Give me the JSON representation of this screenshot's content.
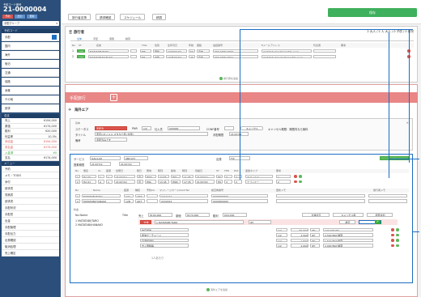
{
  "sidebar": {
    "top_label": "予約コード番号",
    "booking_code": "21-0000004",
    "badges": [
      "予約",
      "出力",
      "更新"
    ],
    "select_value": "手配グループ",
    "section_top": "予約コード",
    "items_a": [
      {
        "label": "手配",
        "value": ""
      },
      {
        "label": "国内",
        "value": ""
      },
      {
        "label": "海外",
        "value": ""
      },
      {
        "label": "宿泊",
        "value": ""
      },
      {
        "label": "交通",
        "value": ""
      },
      {
        "label": "保険",
        "value": ""
      },
      {
        "label": "添乗",
        "value": ""
      },
      {
        "label": "その他",
        "value": ""
      },
      {
        "label": "請求",
        "value": ""
      }
    ],
    "section_money": "収支",
    "items_b": [
      {
        "label": "売上",
        "value": "¥194,000"
      },
      {
        "label": "原価",
        "value": "¥174,000"
      },
      {
        "label": "粗利",
        "value": "¥20,000"
      },
      {
        "label": "利益率",
        "value": "10.3%"
      },
      {
        "label": "未収金",
        "value": "¥194,000"
      },
      {
        "label": "未払金",
        "value": "¥174,000"
      },
      {
        "label": "入金済",
        "value": "¥0"
      },
      {
        "label": "支払",
        "value": "¥174,000"
      }
    ],
    "section_links": "メニュー",
    "items_c": [
      "予約",
      "メモ・TODO",
      "添付",
      "請求書",
      "見積書",
      "請求書",
      "手配状況",
      "手配書",
      "出金",
      "手配管理"
    ],
    "items_d": [
      "手配出力",
      "出発確認",
      "取消処理",
      "売上確定"
    ]
  },
  "toolbar": {
    "buttons": [
      "旅行者名簿",
      "請求確認",
      "スケジュール",
      "精算"
    ],
    "save": "保存"
  },
  "travelers": {
    "title": "旅行者",
    "counts": "2 大人 / 2 人 大人 / 0 子供 / 0 幼児",
    "tabs": [
      "全体",
      "手配",
      "保険",
      "精算"
    ],
    "headers": [
      "No",
      "ST",
      "名前",
      "Title",
      "性別",
      "生年月日",
      "年齢",
      "国籍",
      "電話番号",
      "Eメールアドレス",
      "代表者",
      "備考"
    ],
    "rows": [
      {
        "no": "1",
        "st": "OK",
        "name": "MATATABI/TARO",
        "title": "MR",
        "sex": "男性",
        "dob": "1970/01/01",
        "age": "50",
        "country": "日本",
        "tel": "090-0000-0000",
        "email": "matatabi-taro@agentdx.co.jp"
      },
      {
        "no": "2",
        "st": "OK",
        "name": "MATATABI/HANAKO",
        "title": "MS",
        "sex": "女性",
        "dob": "1975/01/01",
        "age": "46",
        "country": "日本",
        "tel": "090-0000-0001",
        "email": "matatabi-hanako@agentdx.co.jp"
      }
    ],
    "add_label": "旅行者を追加"
  },
  "trip": {
    "section_title": "手配旅行",
    "subsection_title": "海外エア",
    "form": {
      "status_label": "ステータス",
      "status_value": "手配済",
      "pnr_label": "PNR",
      "pnr_value": "1/2",
      "vendor_label": "仕入先",
      "vendor_value": "000000",
      "confirm_label": "CONF番号",
      "cancel_label": "キャンセル",
      "cancel_note": "キャンセル期限：期限内なら無料",
      "title_label": "タイトル",
      "title_value": "東京⇔ホノルル マタタビ様 (往復)",
      "dates_label": "手配期間",
      "dates_value": "21/07/12",
      "remarks_label": "備考",
      "remarks_value": "手配済みです"
    },
    "air": {
      "service_label": "サービス",
      "service_value": "GAL/LAO",
      "group_value": "ABC123",
      "date_range_label": "搭乗期間",
      "date_from": "21/07/12",
      "date_to": "21/07/19",
      "dep_label": "出発",
      "dep_value": "FIX",
      "headers": [
        "No",
        "便名",
        "CL",
        "座席",
        "出発日",
        "曜日",
        "発地",
        "時刻",
        "着地",
        "時刻",
        "到着日",
        "ST",
        "TER",
        "PAX",
        "運賃タイプ",
        "備考"
      ],
      "rows": [
        {
          "no": "1",
          "flight": "HA 00",
          "cl": "A",
          "seat": "1",
          "date": "21/07/12",
          "dow": "月",
          "from": "HND",
          "dep": "22:55",
          "to": "HNL",
          "arr": "11:05",
          "adate": "21/07/12",
          "st": "HK",
          "ter": "3",
          "pax": "2",
          "type": "エコノミー",
          "note": "1"
        },
        {
          "no": "2",
          "flight": "HA 01",
          "cl": "A",
          "seat": "1",
          "date": "21/07/19",
          "dow": "月",
          "from": "HNL",
          "dep": "13:45",
          "to": "HND",
          "arr": "17:35",
          "adate": "21/07/20",
          "st": "HK",
          "ter": "3",
          "pax": "2",
          "type": "エコノミー",
          "note": "2"
        }
      ]
    },
    "pax": {
      "headers": [
        "No",
        "Name",
        "座席",
        "種別",
        "予約CA",
        "マイレージカード/Card No",
        "航空券番号",
        "更新メモ",
        "旅行者メモ"
      ],
      "rows": [
        {
          "no": "1",
          "name": "MATATABI/TARO",
          "seat": "12A",
          "type": "ADT",
          "ca": "",
          "mile": "1111111",
          "ticket": "0000000000"
        },
        {
          "no": "2",
          "name": "MATATABI/HANAKO",
          "seat": "12B",
          "type": "ADT",
          "ca": "",
          "mile": "2222222",
          "ticket": "0000000000"
        }
      ]
    },
    "fare": {
      "noname_label": "No Name",
      "title_label": "Title",
      "names": [
        "1 MATATABI/TARO",
        "2 MATATABI/HANAKO"
      ],
      "sales_label": "売上",
      "sales_value": "¥194,000",
      "cost_label": "原価",
      "cost_value": "¥174,000",
      "profit_label": "粗利",
      "profit_value": "¥20,000",
      "per_label": "1人あたり",
      "btn_all": "全体表示",
      "btn_cancel": "キャンセル料",
      "btn_add": "項目追加",
      "payer_value": "1 MATATABI/TARO",
      "payer_badge": "全体",
      "currency": "JPY",
      "ok_label": "確定",
      "lines": [
        {
          "label": "航空運賃",
          "qty": "1/2",
          "price": "90,000",
          "cur": "JPY",
          "total": "174,000 JPY"
        },
        {
          "label": "燃油サーチャージ",
          "qty": "1/2",
          "price": "2,500",
          "cur": "JPY",
          "total": "2,500 BSP 精算"
        },
        {
          "label": "空港使用料",
          "qty": "1/2",
          "price": "1,500",
          "cur": "JPY",
          "total": "1,500 BSP 精算"
        },
        {
          "label": "出入国税等",
          "qty": "1/2",
          "price": "2,000",
          "cur": "JPY",
          "total": "2,000 BSP 精算"
        }
      ]
    },
    "add_air": "海外エアを追加"
  },
  "colors": {
    "primary": "#2b4f7a",
    "accent": "#1b6ec2",
    "save": "#3fb05d",
    "danger": "#d9534f",
    "pink": "#e98686"
  }
}
